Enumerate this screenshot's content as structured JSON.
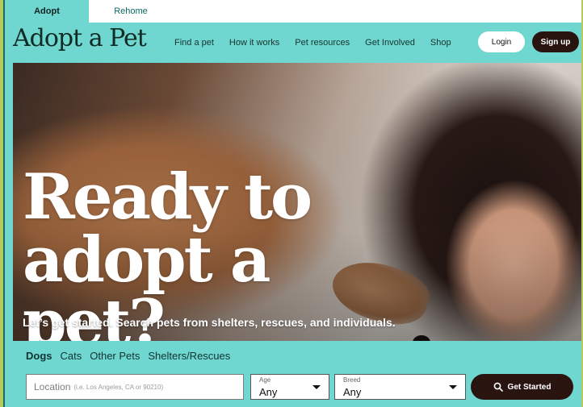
{
  "mode_tabs": {
    "adopt": "Adopt",
    "rehome": "Rehome"
  },
  "header": {
    "logo": "Adopt a Pet",
    "nav": [
      "Find a pet",
      "How it works",
      "Pet resources",
      "Get Involved",
      "Shop"
    ],
    "login": "Login",
    "signup": "Sign up"
  },
  "hero": {
    "title_line1": "Ready to",
    "title_line2": "adopt a pet?",
    "subtitle": "Let’s get started. Search pets from shelters, rescues, and individuals."
  },
  "search": {
    "tabs": [
      "Dogs",
      "Cats",
      "Other Pets",
      "Shelters/Rescues"
    ],
    "active_tab": "Dogs",
    "location_label": "Location",
    "location_placeholder": "(i.e. Los Angeles, CA or 90210)",
    "age": {
      "label": "Age",
      "value": "Any"
    },
    "breed": {
      "label": "Breed",
      "value": "Any"
    },
    "submit": "Get Started"
  },
  "colors": {
    "teal": "#6fd7cf",
    "dark": "#2a1410",
    "outer_frame": "#b5c95c"
  },
  "icons": [
    "search-icon",
    "chevron-down-icon"
  ]
}
